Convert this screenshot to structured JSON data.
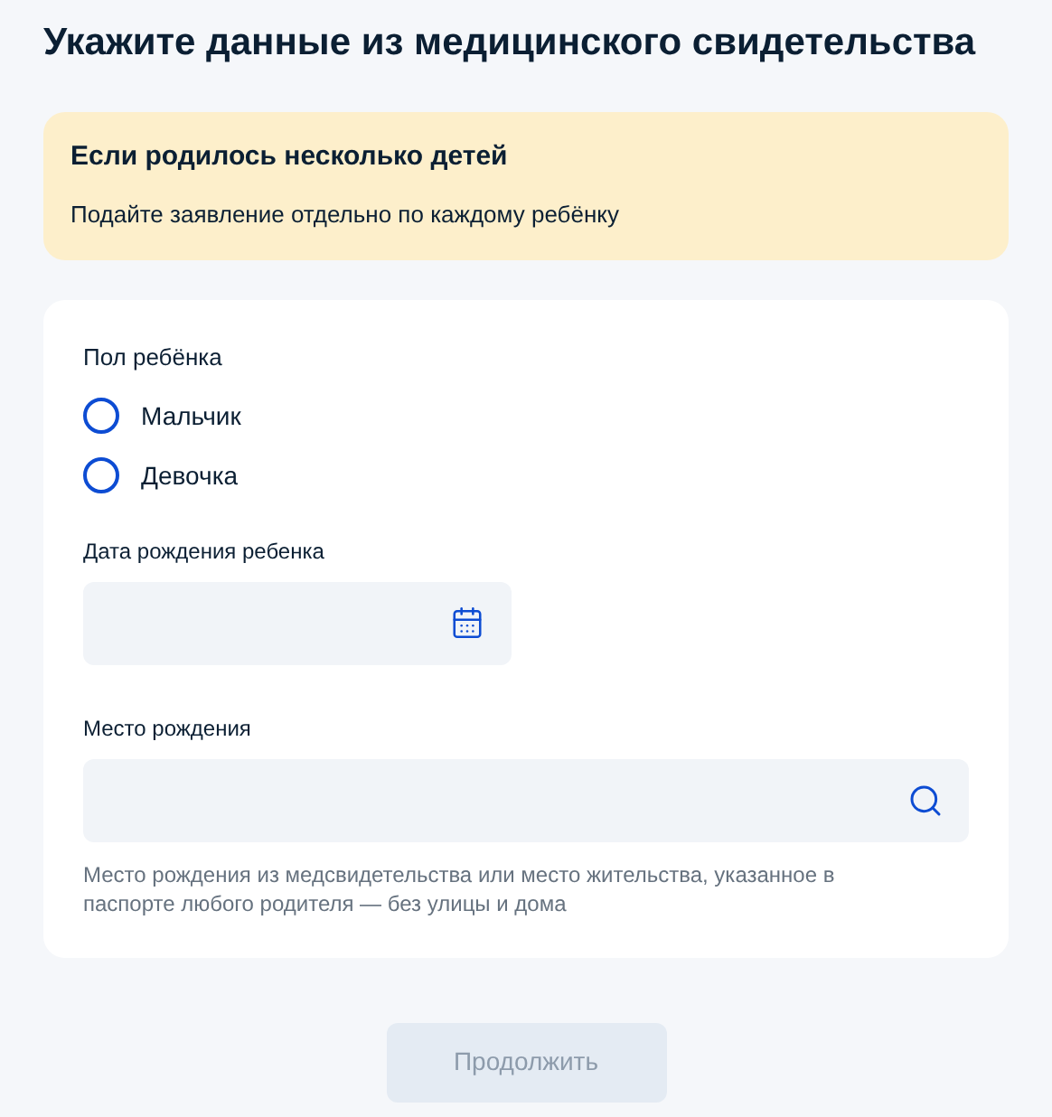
{
  "title": "Укажите данные из медицинского свидетельства",
  "notice": {
    "title": "Если родилось несколько детей",
    "text": "Подайте заявление отдельно по каждому ребёнку"
  },
  "gender": {
    "label": "Пол ребёнка",
    "options": [
      {
        "label": "Мальчик",
        "selected": false
      },
      {
        "label": "Девочка",
        "selected": false
      }
    ]
  },
  "birth_date": {
    "label": "Дата рождения ребенка"
  },
  "birth_place": {
    "label": "Место рождения",
    "hint": "Место рождения из медсвидетельства или место жительства, указанное в паспорте любого родителя — без улицы и дома"
  },
  "continue_button": {
    "label": "Продолжить",
    "disabled": true
  }
}
